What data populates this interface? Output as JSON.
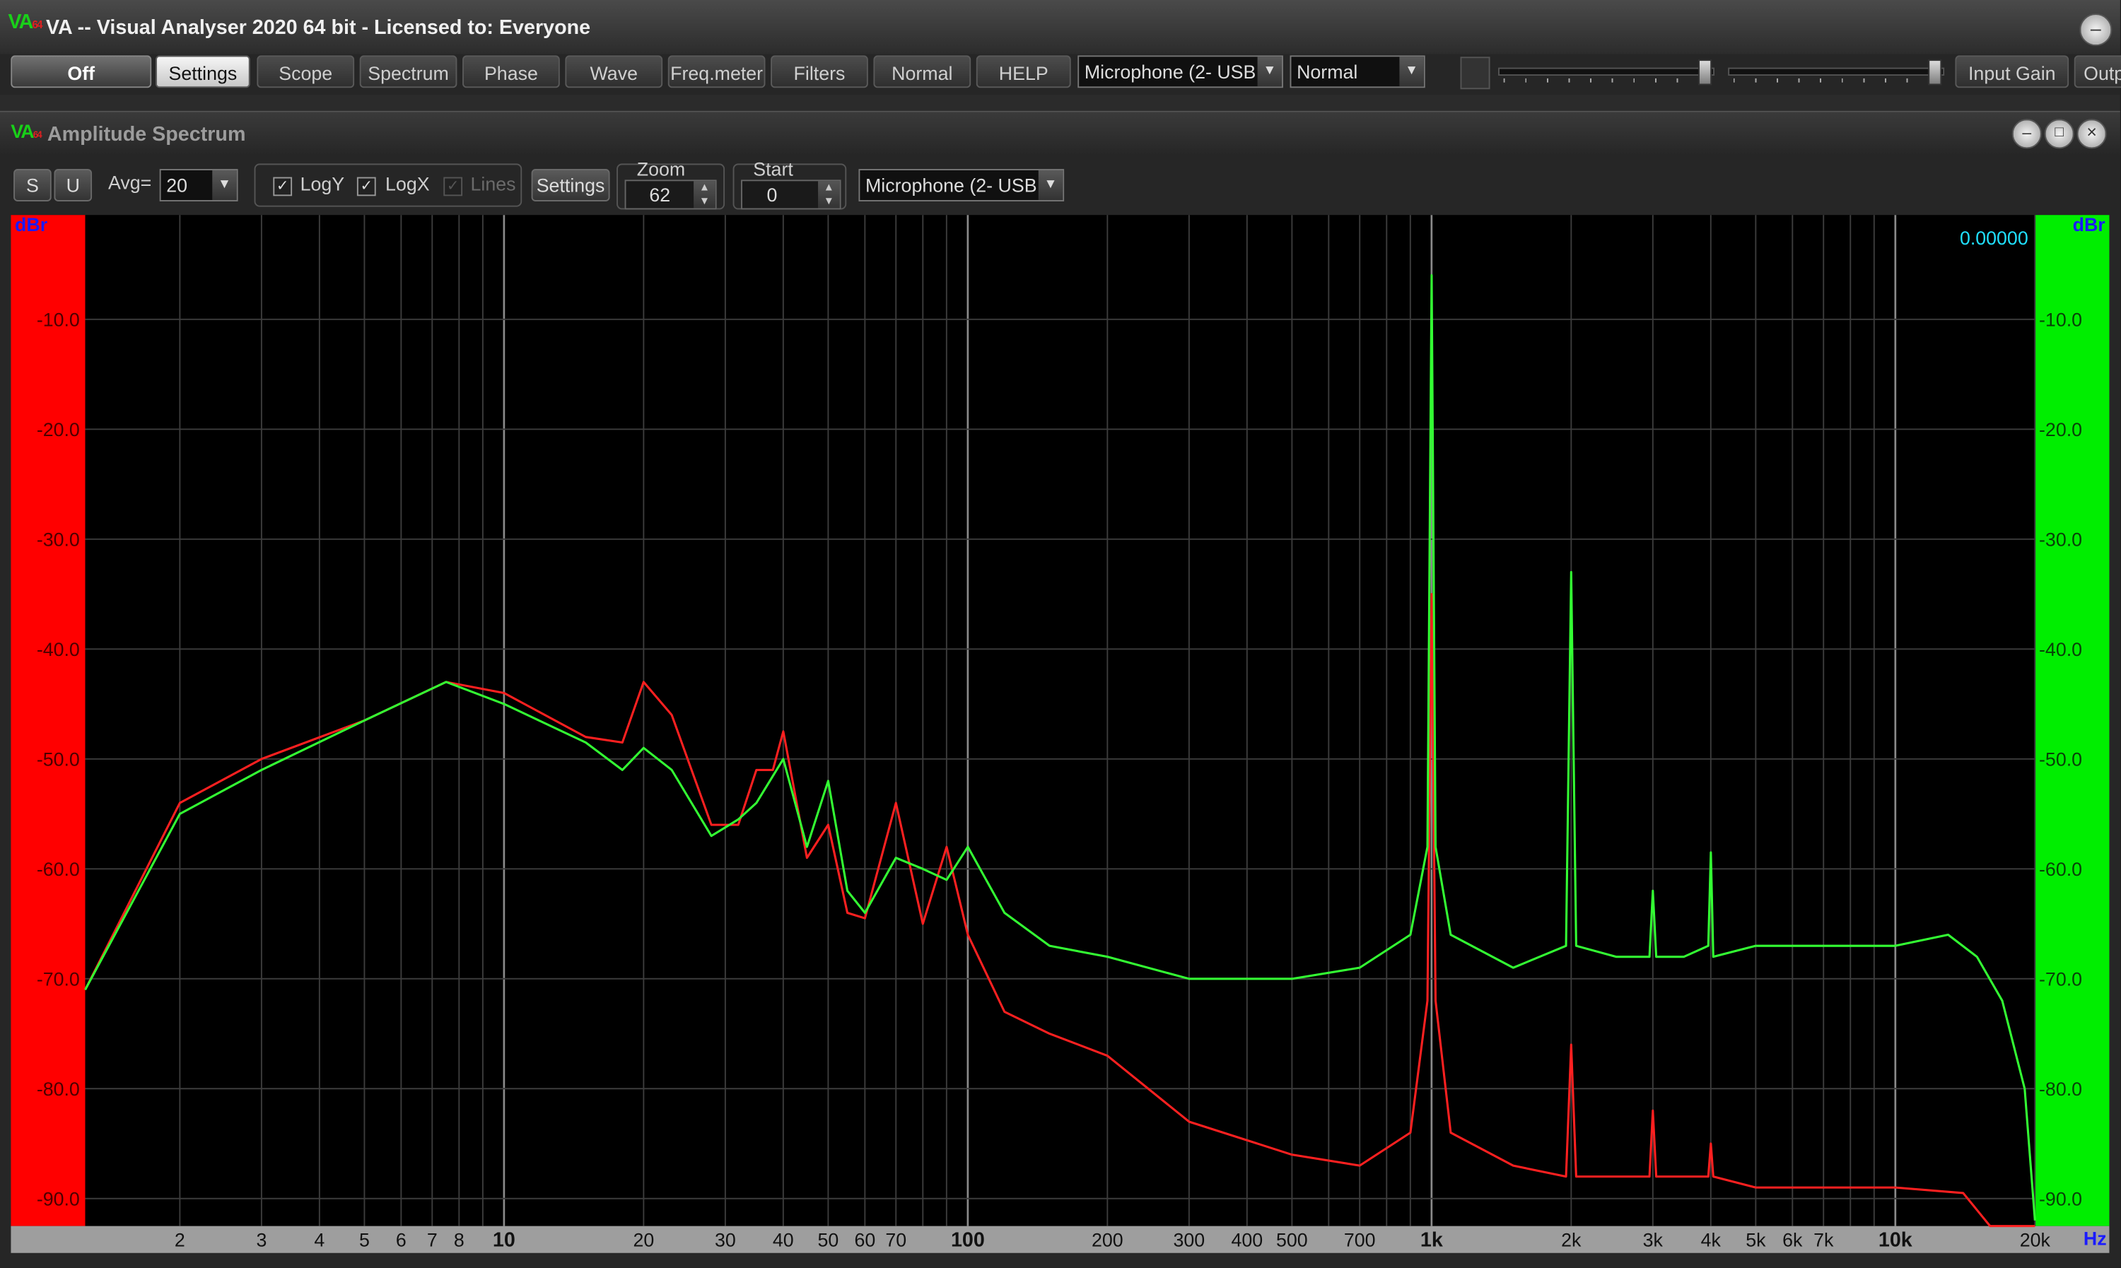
{
  "window": {
    "title": "VA -- Visual Analyser 2020 64 bit - Licensed to: Everyone",
    "logo": "VA",
    "logo_sub": "64",
    "controls": [
      "minimize-icon"
    ]
  },
  "toolbar": {
    "off": "Off",
    "settings": "Settings",
    "scope": "Scope",
    "spectrum": "Spectrum",
    "phase": "Phase",
    "wave": "Wave",
    "freqmeter": "Freq.meter",
    "filters": "Filters",
    "normal_btn": "Normal",
    "help": "HELP",
    "input_device": "Microphone (2- USB",
    "mode": "Normal",
    "input_gain": "Input Gain",
    "output": "Outp"
  },
  "spectrum_window": {
    "title": "Amplitude Spectrum",
    "logo": "VA",
    "s_btn": "S",
    "u_btn": "U",
    "avg_label": "Avg=",
    "avg_value": "20",
    "logy": "LogY",
    "logx": "LogX",
    "lines": "Lines",
    "logy_checked": true,
    "logx_checked": true,
    "lines_checked": true,
    "lines_enabled": false,
    "settings": "Settings",
    "zoom_label": "Zoom",
    "zoom_value": "62",
    "start_label": "Start",
    "start_value": "0",
    "device": "Microphone (2- USB"
  },
  "chart_data": {
    "type": "line",
    "title": "",
    "xlabel": "Hz",
    "ylabel": "dBr",
    "xscale": "log",
    "xlim": [
      1.25,
      20000
    ],
    "ylim": [
      -92.5,
      -0.5
    ],
    "readout": "0.00000",
    "y_ticks": [
      -10,
      -20,
      -30,
      -40,
      -50,
      -60,
      -70,
      -80,
      -90
    ],
    "y_tick_labels": [
      "-10.0",
      "-20.0",
      "-30.0",
      "-40.0",
      "-50.0",
      "-60.0",
      "-70.0",
      "-80.0",
      "-90.0"
    ],
    "x_ticks": [
      2,
      3,
      4,
      5,
      6,
      7,
      8,
      10,
      20,
      30,
      40,
      50,
      60,
      70,
      100,
      200,
      300,
      400,
      500,
      700,
      1000,
      2000,
      3000,
      4000,
      5000,
      6000,
      7000,
      10000,
      20000
    ],
    "x_tick_labels": [
      "2",
      "3",
      "4",
      "5",
      "6",
      "7",
      "8",
      "10",
      "20",
      "30",
      "40",
      "50",
      "60",
      "70",
      "100",
      "200",
      "300",
      "400",
      "500",
      "700",
      "1k",
      "2k",
      "3k",
      "4k",
      "5k",
      "6k",
      "7k",
      "10k",
      "20k"
    ],
    "x_bold_labels": [
      "10",
      "100",
      "1k",
      "10k"
    ],
    "left_bar_color": "#ff0000",
    "right_bar_color": "#00ee00",
    "grid": true,
    "series": [
      {
        "color": "#ff2020",
        "x": [
          1.25,
          2,
          3,
          5,
          7.5,
          10,
          15,
          18,
          20,
          23,
          28,
          32,
          35,
          38,
          40,
          45,
          50,
          55,
          60,
          70,
          80,
          90,
          100,
          120,
          150,
          200,
          300,
          500,
          700,
          900,
          980,
          1000,
          1020,
          1100,
          1500,
          1950,
          2000,
          2050,
          2500,
          2950,
          3000,
          3050,
          3500,
          3950,
          4000,
          4050,
          5000,
          7000,
          10000,
          14000,
          16000,
          20000
        ],
        "y": [
          -71,
          -54,
          -50,
          -46.5,
          -43,
          -44,
          -48,
          -48.5,
          -43,
          -46,
          -56,
          -56,
          -51,
          -51,
          -47.5,
          -59,
          -56,
          -64,
          -64.5,
          -54,
          -65,
          -58,
          -66,
          -73,
          -75,
          -77,
          -83,
          -86,
          -87,
          -84,
          -72,
          -35,
          -72,
          -84,
          -87,
          -88,
          -76,
          -88,
          -88,
          -88,
          -82,
          -88,
          -88,
          -88,
          -85,
          -88,
          -89,
          -89,
          -89,
          -89.5,
          -92.5,
          -92.5
        ]
      },
      {
        "color": "#33ff33",
        "x": [
          1.25,
          2,
          3,
          5,
          7.5,
          10,
          15,
          18,
          20,
          23,
          28,
          32,
          35,
          40,
          45,
          50,
          55,
          60,
          70,
          80,
          90,
          100,
          120,
          150,
          200,
          300,
          500,
          700,
          900,
          980,
          1000,
          1020,
          1100,
          1500,
          1950,
          2000,
          2050,
          2500,
          2950,
          3000,
          3050,
          3500,
          3950,
          4000,
          4050,
          5000,
          7000,
          10000,
          13000,
          15000,
          17000,
          19000,
          20000
        ],
        "y": [
          -71,
          -55,
          -51,
          -46.5,
          -43,
          -45,
          -48.5,
          -51,
          -49,
          -51,
          -57,
          -55.5,
          -54,
          -50,
          -58,
          -52,
          -62,
          -64,
          -59,
          -60,
          -61,
          -58,
          -64,
          -67,
          -68,
          -70,
          -70,
          -69,
          -66,
          -58,
          -6,
          -58,
          -66,
          -69,
          -67,
          -33,
          -67,
          -68,
          -68,
          -62,
          -68,
          -68,
          -67,
          -58.5,
          -68,
          -67,
          -67,
          -67,
          -66,
          -68,
          -72,
          -80,
          -92
        ]
      }
    ]
  }
}
